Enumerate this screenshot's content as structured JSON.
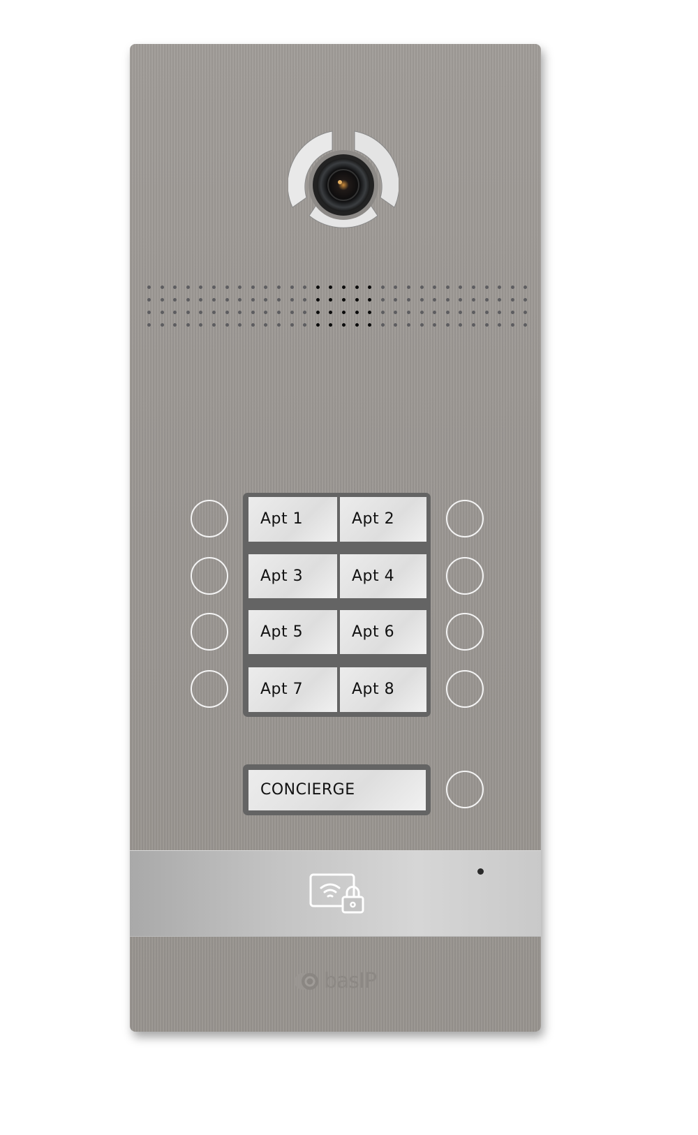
{
  "device": {
    "brand": "basIP",
    "buttons": [
      {
        "label": "Apt 1"
      },
      {
        "label": "Apt 2"
      },
      {
        "label": "Apt 3"
      },
      {
        "label": "Apt 4"
      },
      {
        "label": "Apt 5"
      },
      {
        "label": "Apt 6"
      },
      {
        "label": "Apt 7"
      },
      {
        "label": "Apt 8"
      }
    ],
    "concierge": {
      "label": "CONCIERGE"
    },
    "icons": [
      "camera-icon",
      "speaker-grille-icon",
      "call-button-ring-icon",
      "card-reader-lock-icon",
      "microphone-hole-icon",
      "basip-logo-icon"
    ],
    "colors": {
      "panel": "#9c9894",
      "label_plate": "#646464",
      "label_face": "#e6e6e6",
      "reader_band": "#c6c6c6"
    }
  }
}
